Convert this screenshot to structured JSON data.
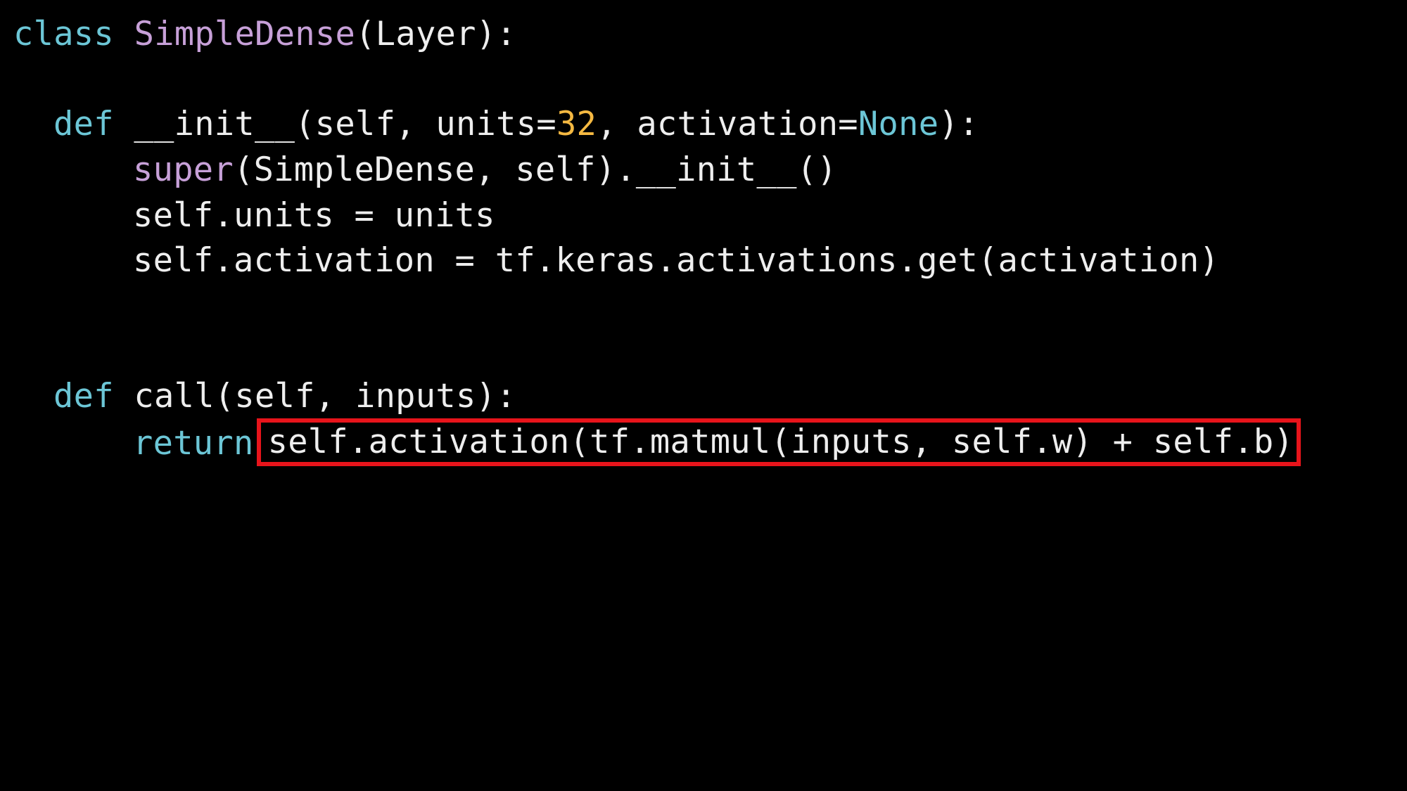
{
  "code": {
    "line1": {
      "kw": "class",
      "class_name": "SimpleDense",
      "rest": "(Layer):"
    },
    "line3": {
      "kw": "def",
      "sig_a": "__init__(self, units=",
      "num": "32",
      "sig_b": ", activation=",
      "none_kw": "None",
      "sig_c": "):"
    },
    "line4": {
      "builtin": "super",
      "rest": "(SimpleDense, self).__init__()"
    },
    "line5": {
      "text": "self.units = units"
    },
    "line6": {
      "text": "self.activation = tf.keras.activations.get(activation)"
    },
    "line9": {
      "kw": "def",
      "rest": "call(self, inputs):"
    },
    "line10": {
      "kw": "return",
      "highlighted_expr": "self.activation(tf.matmul(inputs, self.w) + self.b)"
    }
  },
  "colors": {
    "background": "#000000",
    "text": "#eeeeee",
    "keyword": "#6cc6d6",
    "class_name": "#c7a0d8",
    "number": "#f5b942",
    "highlight_border": "#e8141b"
  }
}
